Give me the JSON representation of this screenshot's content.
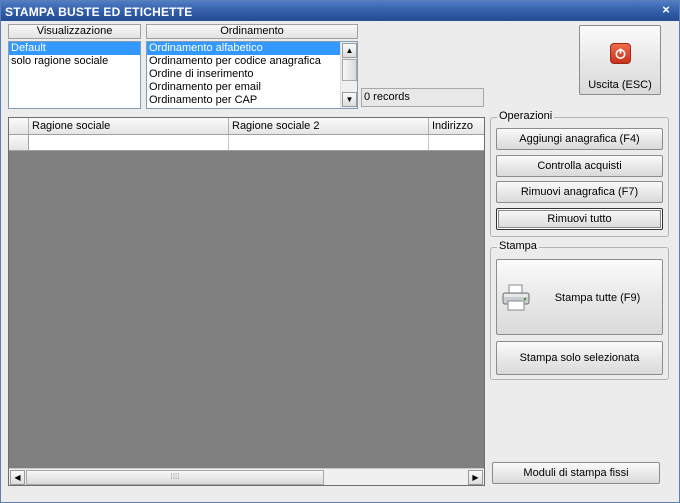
{
  "window": {
    "title": "STAMPA BUSTE ED ETICHETTE",
    "close_glyph": "×"
  },
  "visualizzazione": {
    "label": "Visualizzazione",
    "items": [
      {
        "label": "Default",
        "selected": true
      },
      {
        "label": "solo ragione sociale",
        "selected": false
      }
    ]
  },
  "ordinamento": {
    "label": "Ordinamento",
    "items": [
      {
        "label": "Ordinamento alfabetico",
        "selected": true
      },
      {
        "label": "Ordinamento per codice anagrafica",
        "selected": false
      },
      {
        "label": "Ordine di inserimento",
        "selected": false
      },
      {
        "label": "Ordinamento per email",
        "selected": false
      },
      {
        "label": "Ordinamento per CAP",
        "selected": false
      }
    ]
  },
  "records": "0 records",
  "grid": {
    "columns": [
      "Ragione sociale",
      "Ragione sociale 2",
      "Indirizzo"
    ],
    "rows": [
      [
        "",
        "",
        ""
      ]
    ]
  },
  "exit_button": {
    "label": "Uscita (ESC)",
    "icon": "power-icon"
  },
  "operazioni": {
    "label": "Operazioni",
    "buttons": [
      "Aggiungi anagrafica (F4)",
      "Controlla acquisti",
      "Rimuovi anagrafica (F7)",
      "Rimuovi tutto"
    ]
  },
  "stampa": {
    "label": "Stampa",
    "print_all": "Stampa tutte (F9)",
    "print_selected": "Stampa solo selezionata",
    "icon": "printer-icon"
  },
  "moduli_button": "Moduli di stampa fissi",
  "colors": {
    "title_bar": "#2f5aa5",
    "selection": "#3399ff",
    "grid_bg": "#808080",
    "stop_icon": "#d9412a"
  }
}
